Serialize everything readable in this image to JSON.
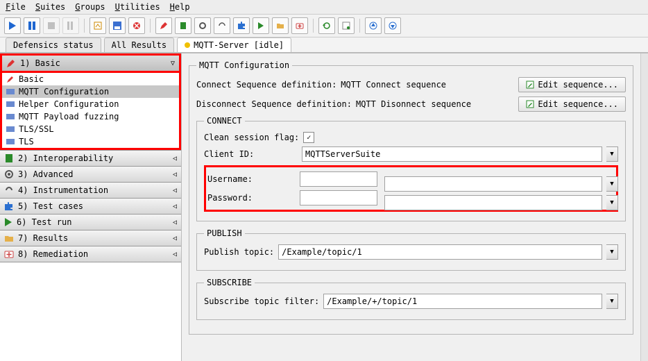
{
  "menubar": {
    "file": "File",
    "suites": "Suites",
    "groups": "Groups",
    "utilities": "Utilities",
    "help": "Help"
  },
  "tabs": {
    "defensics": "Defensics status",
    "all": "All Results",
    "mqtt": "MQTT-Server [idle]"
  },
  "sidebar": {
    "basic": {
      "title": "1) Basic",
      "items": [
        "Basic",
        "MQTT Configuration",
        "Helper Configuration",
        "MQTT Payload fuzzing",
        "TLS/SSL",
        "TLS"
      ]
    },
    "interop": "2) Interoperability",
    "advanced": "3) Advanced",
    "instr": "4) Instrumentation",
    "cases": "5) Test cases",
    "run": "6) Test run",
    "results": "7) Results",
    "remed": "8) Remediation"
  },
  "main": {
    "legend": "MQTT Configuration",
    "rows": {
      "conn_def_label": "Connect Sequence definition:",
      "conn_def_value": "MQTT Connect sequence",
      "disc_def_label": "Disconnect Sequence definition:",
      "disc_def_value": "MQTT Disonnect sequence",
      "edit_seq": "Edit sequence..."
    },
    "connect": {
      "legend": "CONNECT",
      "clean_label": "Clean session flag:",
      "clientid_label": "Client ID:",
      "clientid_value": "MQTTServerSuite",
      "user_label": "Username:",
      "pass_label": "Password:"
    },
    "publish": {
      "legend": "PUBLISH",
      "label": "Publish topic:",
      "value": "/Example/topic/1"
    },
    "subscribe": {
      "legend": "SUBSCRIBE",
      "label": "Subscribe topic filter:",
      "value": "/Example/+/topic/1"
    }
  }
}
